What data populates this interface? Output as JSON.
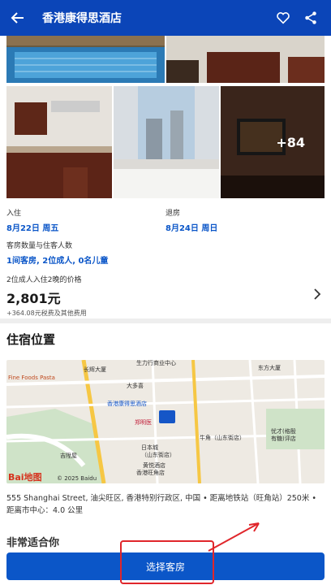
{
  "header": {
    "title": "香港康得思酒店"
  },
  "photos": {
    "more_count": "+84"
  },
  "checkin": {
    "label": "入住",
    "date": "8月22日 周五"
  },
  "checkout": {
    "label": "退房",
    "date": "8月24日 周日"
  },
  "guests": {
    "label": "客房数量与住客人数",
    "value": "1间客房, 2位成人, 0名儿童"
  },
  "price": {
    "label": "2位成人入住2晚的价格",
    "amount": "2,801元",
    "tax": "+364.08元税费及其他费用"
  },
  "location": {
    "title": "住宿位置",
    "address": "555 Shanghai Street, 油尖旺区, 香港特别行政区, 中国 • 距离地铁站（旺角站）250米 • 距离市中心：4.0 公里"
  },
  "map": {
    "labels": [
      "生力行商业中心",
      "长辉大厦",
      "东方大厦",
      "Fine Foods Pasta",
      "大多喜",
      "香港康得思酒店",
      "郑明医",
      "吉陞屋",
      "日本城（山东街店）",
      "黄悦酒店",
      "香港旺角店",
      "牛角（山东街店）",
      "忧才(格殷有糖)评店"
    ],
    "baidu": "Bai地图",
    "copyright": "© 2025 Baidu"
  },
  "next_section": {
    "title": "非常适合你"
  },
  "cta": {
    "label": "选择客房"
  }
}
